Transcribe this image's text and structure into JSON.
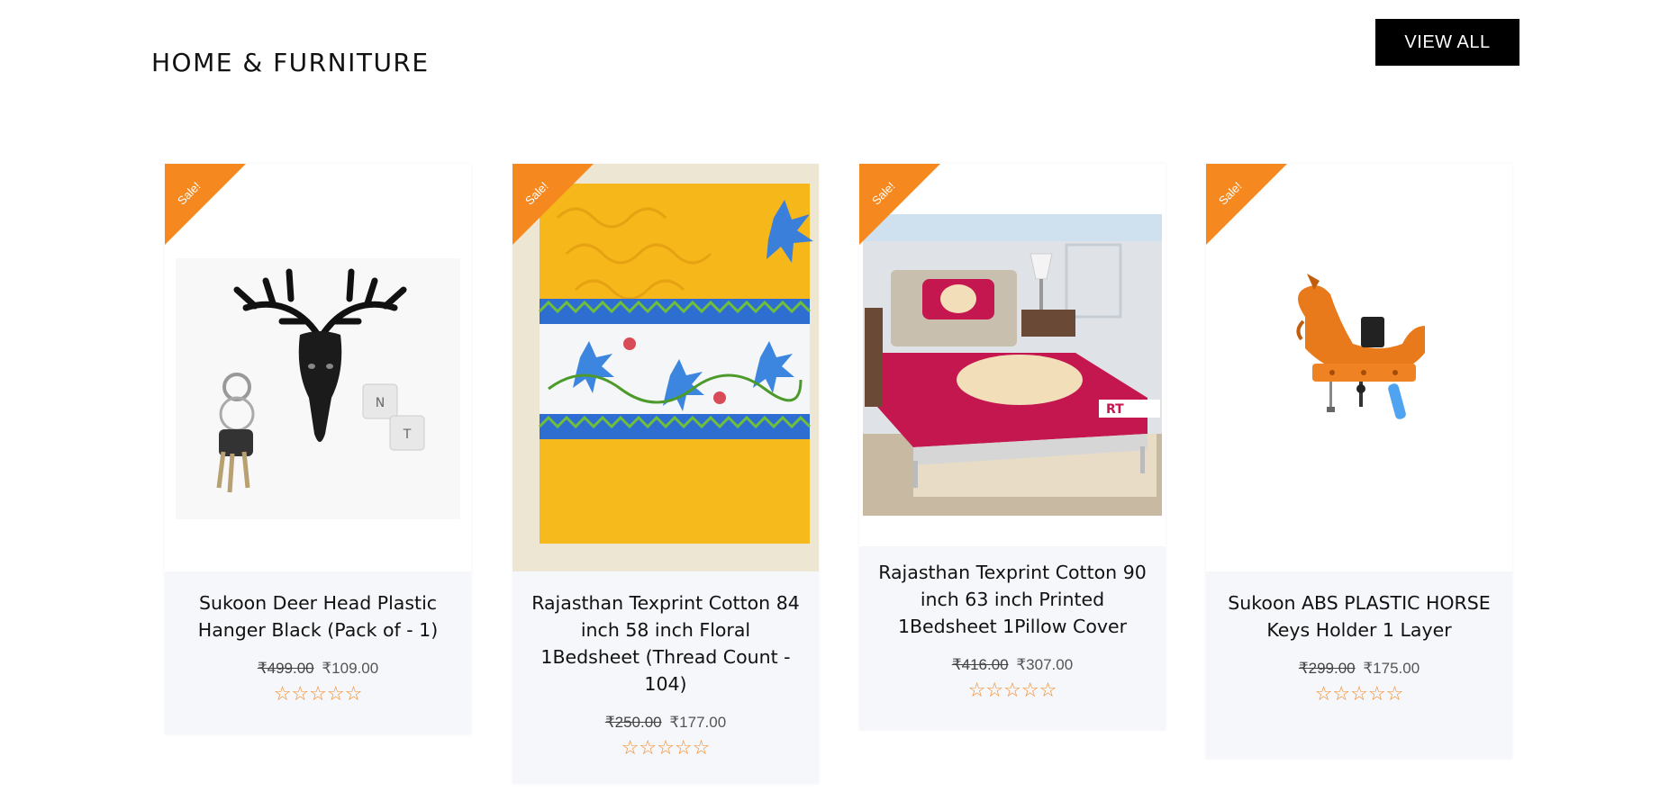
{
  "section": {
    "title": "HOME & FURNITURE",
    "view_all_label": "VIEW ALL"
  },
  "colors": {
    "sale_ribbon": "#f5891f",
    "star": "#f28b2b",
    "button_bg": "#000000",
    "info_bg": "#f6f7fb"
  },
  "products": [
    {
      "badge": "Sale!",
      "name": "Sukoon Deer Head Plastic Hanger Black (Pack of - 1)",
      "old_price": "₹499.00",
      "price": "₹109.00",
      "stars": "☆☆☆☆☆",
      "rating": 0,
      "image_icon": "deer-head-hanger-image"
    },
    {
      "badge": "Sale!",
      "name": "Rajasthan Texprint Cotton 84 inch 58 inch Floral 1Bedsheet (Thread Count - 104)",
      "old_price": "₹250.00",
      "price": "₹177.00",
      "stars": "☆☆☆☆☆",
      "rating": 0,
      "image_icon": "floral-bedsheet-image"
    },
    {
      "badge": "Sale!",
      "name": "Rajasthan Texprint Cotton 90 inch 63 inch Printed 1Bedsheet 1Pillow Cover",
      "old_price": "₹416.00",
      "price": "₹307.00",
      "stars": "☆☆☆☆☆",
      "rating": 0,
      "image_icon": "bed-with-bedsheet-image"
    },
    {
      "badge": "Sale!",
      "name": "Sukoon ABS PLASTIC HORSE Keys Holder 1 Layer",
      "old_price": "₹299.00",
      "price": "₹175.00",
      "stars": "☆☆☆☆☆",
      "rating": 0,
      "image_icon": "horse-key-holder-image"
    }
  ]
}
